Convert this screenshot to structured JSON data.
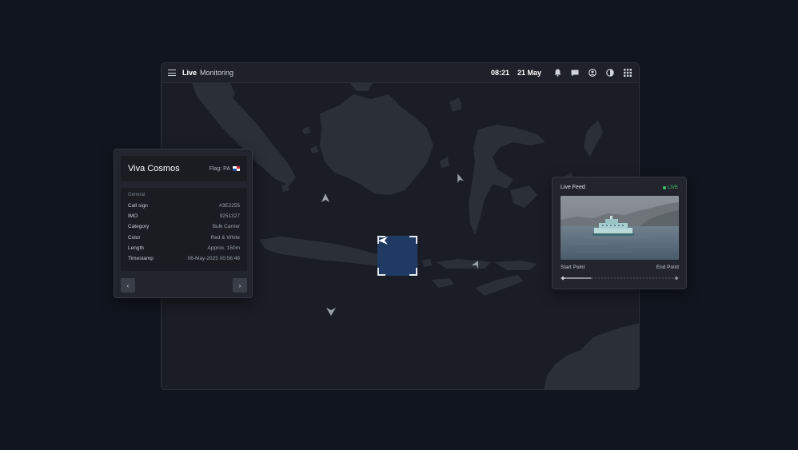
{
  "header": {
    "title_strong": "Live",
    "title": "Monitoring",
    "time": "08:21",
    "date": "21 May",
    "icons": [
      "bell-icon",
      "chat-icon",
      "user-icon",
      "contrast-icon",
      "grid-icon"
    ]
  },
  "vessel": {
    "name": "Viva Cosmos",
    "flag_label": "Flag: PA",
    "section": "General",
    "fields": [
      {
        "label": "Call sign",
        "value": "#3E2255"
      },
      {
        "label": "IMO",
        "value": "9251327"
      },
      {
        "label": "Category",
        "value": "Bulk Carrier"
      },
      {
        "label": "Color",
        "value": "Red & White"
      },
      {
        "label": "Length",
        "value": "Approx. 150m"
      },
      {
        "label": "Timestamp",
        "value": "06-May-2025 00:56:48"
      }
    ],
    "prev_label": "‹",
    "next_label": "›"
  },
  "feed": {
    "title": "Live Feed",
    "status": "LIVE",
    "start_label": "Start Point",
    "end_label": "End Point",
    "progress": 0.25
  },
  "colors": {
    "accent_live": "#3fc46b",
    "target_fill": "#1f3a63",
    "land": "#2b2f38",
    "sea": "#1a1d25"
  }
}
